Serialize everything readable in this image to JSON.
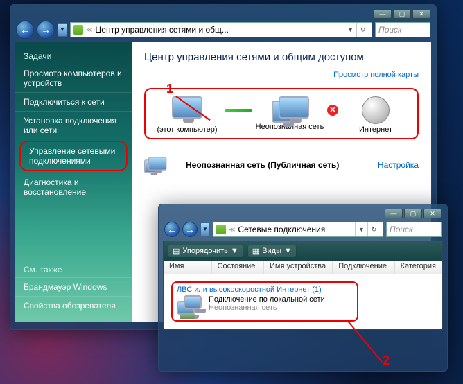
{
  "win1": {
    "breadcrumb": "Центр управления сетями и общ...",
    "search_placeholder": "Поиск",
    "sidebar": {
      "tasks_heading": "Задачи",
      "items": [
        "Просмотр компьютеров и устройств",
        "Подключиться к сети",
        "Установка подключения или сети",
        "Управление сетевыми подключениями",
        "Диагностика и восстановление"
      ],
      "see_also": "См. также",
      "see_also_items": [
        "Брандмауэр Windows",
        "Свойства обозревателя"
      ]
    },
    "main": {
      "title": "Центр управления сетями и общим доступом",
      "map_link": "Просмотр полной карты",
      "nodes": {
        "this_pc": "(этот компьютер)",
        "unknown": "Неопознанная сеть",
        "internet": "Интернет"
      },
      "network_row": "Неопознанная сеть (Публичная сеть)",
      "configure": "Настройка"
    }
  },
  "win2": {
    "breadcrumb": "Сетевые подключения",
    "search_placeholder": "Поиск",
    "organize": "Упорядочить",
    "views": "Виды",
    "columns": [
      "Имя",
      "Состояние",
      "Имя устройства",
      "Подключение",
      "Категория"
    ],
    "group_label": "ЛВС или высокоскоростной Интернет (1)",
    "conn_name": "Подключение по локальной сети",
    "conn_status": "Неопознанная сеть"
  },
  "callouts": {
    "one": "1",
    "two": "2"
  },
  "titlebar": {
    "min": "—",
    "max": "▢",
    "close": "✕"
  }
}
